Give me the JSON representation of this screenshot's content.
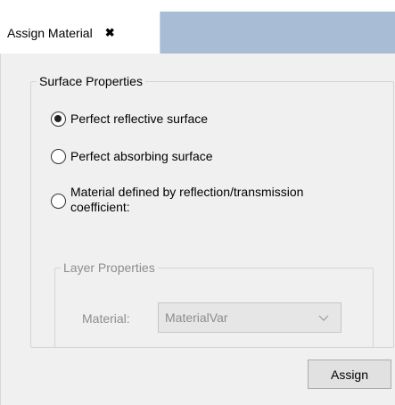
{
  "tab": {
    "label": "Assign Material",
    "close_glyph": "✖"
  },
  "surface_properties": {
    "title": "Surface Properties",
    "options": [
      {
        "label": "Perfect reflective surface",
        "selected": true
      },
      {
        "label": "Perfect absorbing surface",
        "selected": false
      },
      {
        "label": "Material defined by reflection/transmission coefficient:",
        "selected": false
      }
    ]
  },
  "layer_properties": {
    "title": "Layer Properties",
    "material_label": "Material:",
    "material_value": "MaterialVar",
    "enabled": false
  },
  "assign_button": {
    "label": "Assign"
  },
  "colors": {
    "tab_strip": "#a9bcd6",
    "panel_bg": "#f0f0f0",
    "disabled_text": "#8d8d8d"
  },
  "icons": [
    "close-icon",
    "chevron-down-icon"
  ]
}
